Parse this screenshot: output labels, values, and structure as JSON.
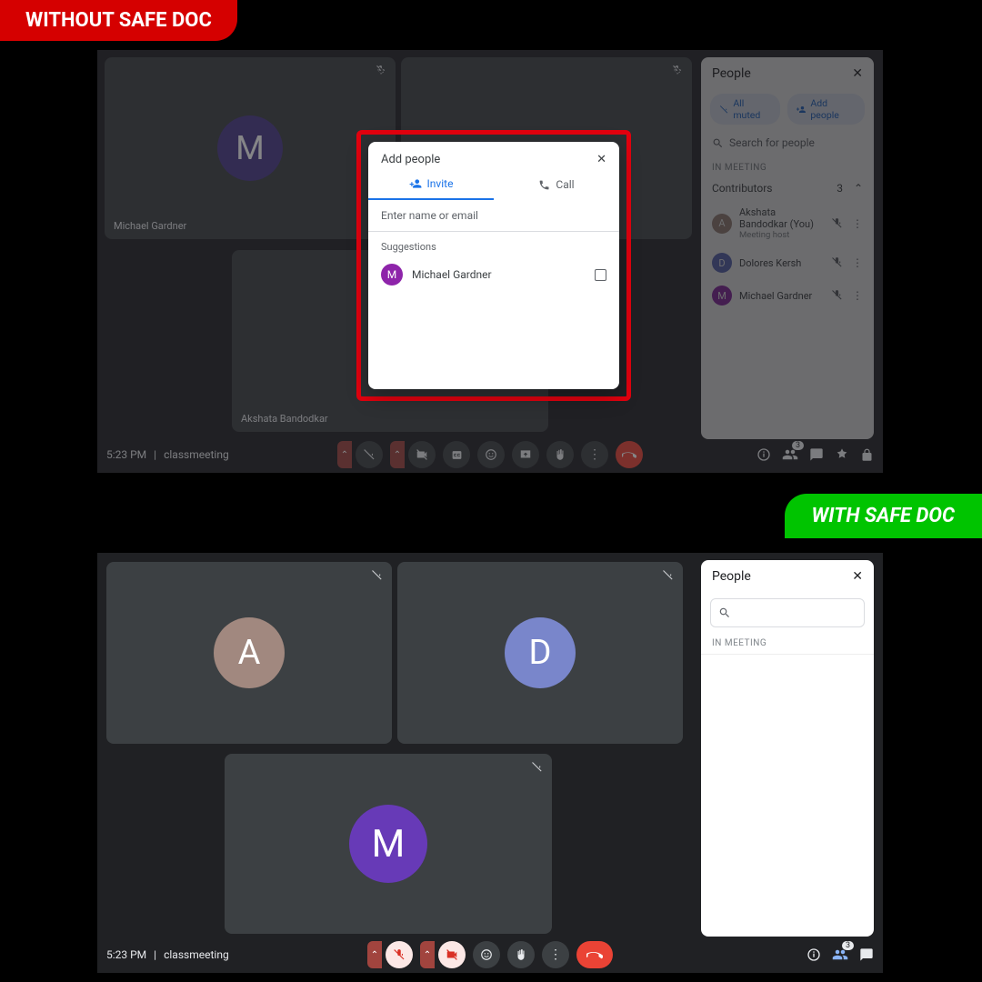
{
  "badges": {
    "without": "WITHOUT SAFE DOC",
    "with": "WITH SAFE DOC"
  },
  "top": {
    "tiles": [
      {
        "initial": "M",
        "name": "Michael Gardner",
        "color": "#4b3a8a"
      },
      {
        "initial": "",
        "name": "",
        "color": "#5c6bc0"
      },
      {
        "initial": "",
        "name": "Akshata Bandodkar",
        "color": "#8d6e63"
      }
    ],
    "dialog": {
      "title": "Add people",
      "tab_invite": "Invite",
      "tab_call": "Call",
      "input_placeholder": "Enter name or email",
      "suggestions_label": "Suggestions",
      "suggestion_name": "Michael Gardner",
      "suggestion_initial": "M"
    },
    "panel": {
      "title": "People",
      "chip_muted": "All muted",
      "chip_add": "Add people",
      "search_placeholder": "Search for people",
      "section": "IN MEETING",
      "contributors_label": "Contributors",
      "contributors_count": "3",
      "people": [
        {
          "initial": "A",
          "name": "Akshata Bandodkar (You)",
          "sub": "Meeting host",
          "color": "#a1887f"
        },
        {
          "initial": "D",
          "name": "Dolores Kersh",
          "sub": "",
          "color": "#5c6bc0"
        },
        {
          "initial": "M",
          "name": "Michael Gardner",
          "sub": "",
          "color": "#8e24aa"
        }
      ]
    },
    "bar": {
      "time": "5:23 PM",
      "name": "classmeeting",
      "count": "3"
    }
  },
  "bot": {
    "tiles": [
      {
        "initial": "A",
        "color": "#a1887f"
      },
      {
        "initial": "D",
        "color": "#7986cb"
      },
      {
        "initial": "M",
        "color": "#673ab7"
      }
    ],
    "panel": {
      "title": "People",
      "section": "IN MEETING"
    },
    "bar": {
      "time": "5:23 PM",
      "name": "classmeeting",
      "count": "3"
    }
  }
}
